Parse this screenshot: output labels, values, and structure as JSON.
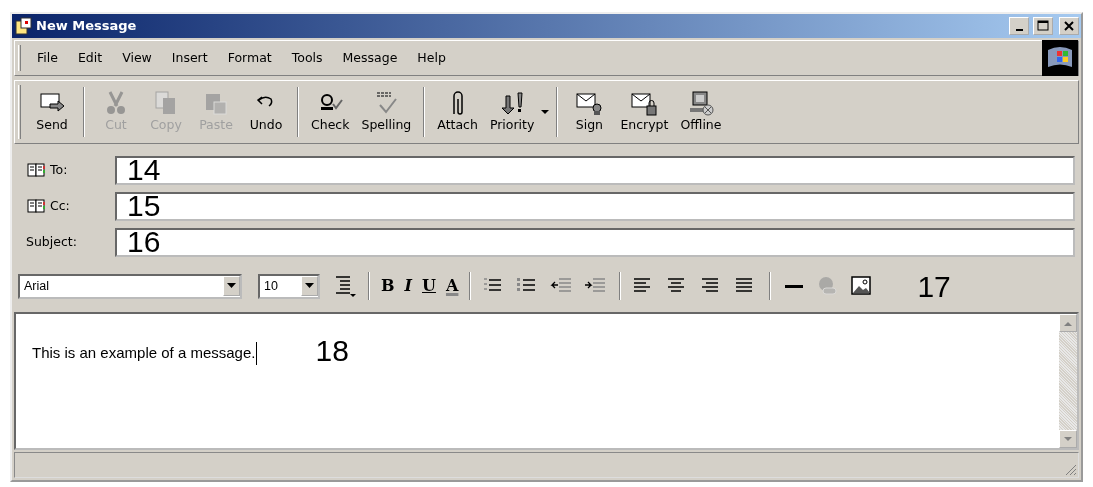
{
  "window": {
    "title": "New Message"
  },
  "menu": [
    {
      "label": "File"
    },
    {
      "label": "Edit"
    },
    {
      "label": "View"
    },
    {
      "label": "Insert"
    },
    {
      "label": "Format"
    },
    {
      "label": "Tools"
    },
    {
      "label": "Message"
    },
    {
      "label": "Help"
    }
  ],
  "toolbar_groups": [
    {
      "buttons": [
        {
          "label": "Send",
          "disabled": false,
          "dropdown": false
        }
      ]
    },
    {
      "buttons": [
        {
          "label": "Cut",
          "disabled": true,
          "dropdown": false
        },
        {
          "label": "Copy",
          "disabled": true,
          "dropdown": false
        },
        {
          "label": "Paste",
          "disabled": true,
          "dropdown": false
        },
        {
          "label": "Undo",
          "disabled": false,
          "dropdown": false
        }
      ]
    },
    {
      "buttons": [
        {
          "label": "Check",
          "disabled": false,
          "dropdown": false
        },
        {
          "label": "Spelling",
          "disabled": false,
          "dropdown": false
        }
      ]
    },
    {
      "buttons": [
        {
          "label": "Attach",
          "disabled": false,
          "dropdown": false
        },
        {
          "label": "Priority",
          "disabled": false,
          "dropdown": true
        }
      ]
    },
    {
      "buttons": [
        {
          "label": "Sign",
          "disabled": false,
          "dropdown": false
        },
        {
          "label": "Encrypt",
          "disabled": false,
          "dropdown": false
        },
        {
          "label": "Offline",
          "disabled": false,
          "dropdown": false
        }
      ]
    }
  ],
  "fields": [
    {
      "label": "To:",
      "address_book": true,
      "callout": "14"
    },
    {
      "label": "Cc:",
      "address_book": true,
      "callout": "15"
    },
    {
      "label": "Subject:",
      "address_book": false,
      "callout": "16"
    }
  ],
  "format_bar": {
    "font": "Arial",
    "size": "10",
    "callout": "17",
    "groups": [
      {
        "tools": [
          {
            "kind": "icon",
            "disabled": false
          }
        ]
      },
      {
        "tools": [
          {
            "kind": "bold",
            "label": "B"
          },
          {
            "kind": "italic",
            "label": "I"
          },
          {
            "kind": "underline",
            "label": "U"
          },
          {
            "kind": "color",
            "label": "A"
          }
        ]
      },
      {
        "tools": [
          {
            "kind": "icon",
            "disabled": false
          },
          {
            "kind": "icon",
            "disabled": false
          },
          {
            "kind": "icon",
            "disabled": false
          },
          {
            "kind": "icon",
            "disabled": false
          }
        ]
      },
      {
        "tools": [
          {
            "kind": "icon",
            "disabled": false
          },
          {
            "kind": "icon",
            "disabled": false
          },
          {
            "kind": "icon",
            "disabled": false
          },
          {
            "kind": "icon",
            "disabled": false
          }
        ]
      },
      {
        "tools": [
          {
            "kind": "icon",
            "disabled": false
          },
          {
            "kind": "icon",
            "disabled": true
          },
          {
            "kind": "icon",
            "disabled": false
          }
        ]
      }
    ]
  },
  "message": {
    "text": "This is an example of a message.",
    "callout": "18"
  }
}
